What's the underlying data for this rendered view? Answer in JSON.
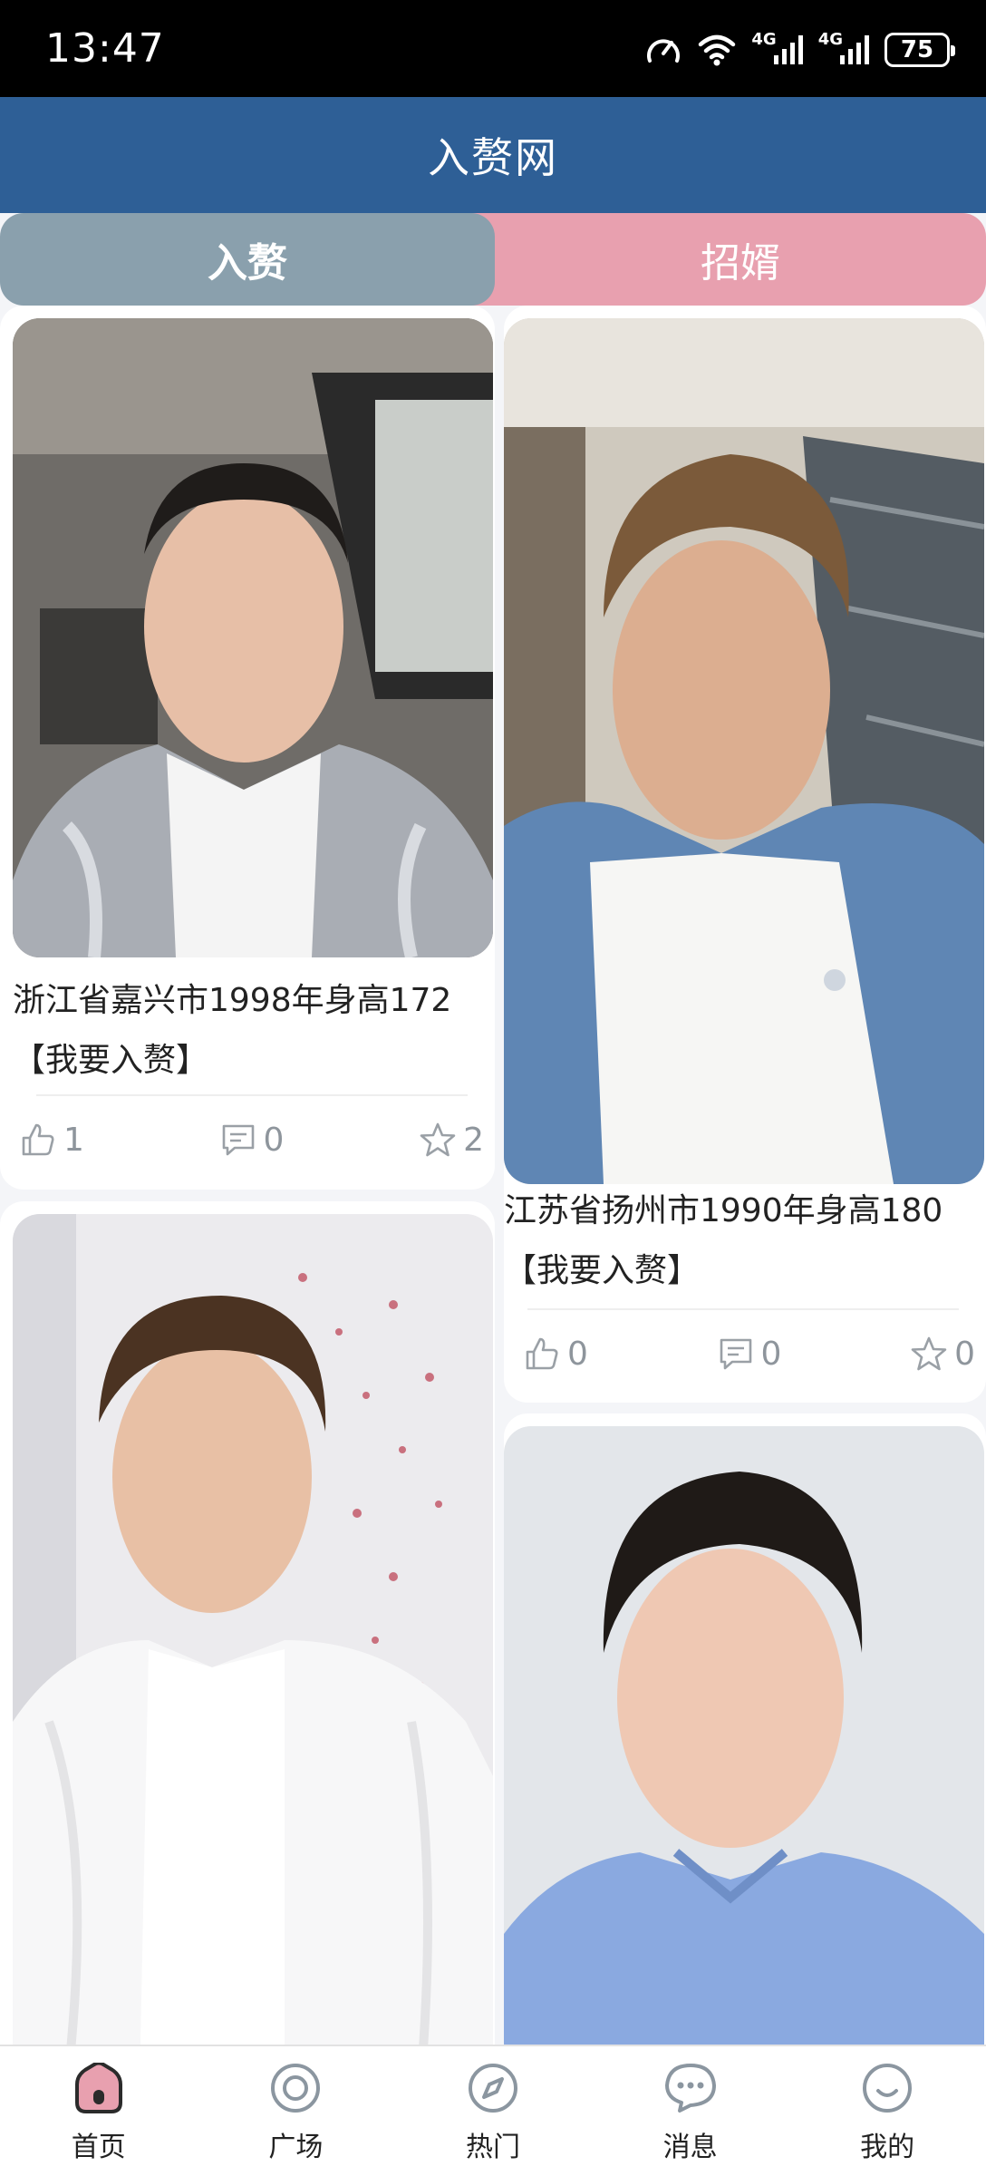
{
  "status_bar": {
    "time": "13:47",
    "network_1": "4G",
    "network_2": "4G",
    "battery": "75"
  },
  "header": {
    "title": "入赘网"
  },
  "tabs": [
    {
      "label": "入赘",
      "active": true
    },
    {
      "label": "招婿",
      "active": false
    }
  ],
  "cards": [
    {
      "title": "浙江省嘉兴市1998年身高172",
      "tag": "【我要入赘】",
      "likes": "1",
      "comments": "0",
      "favorites": "2"
    },
    {
      "title": "江苏省扬州市1990年身高180",
      "tag": "【我要入赘】",
      "likes": "0",
      "comments": "0",
      "favorites": "0"
    },
    {
      "title": "",
      "tag": "",
      "likes": "",
      "comments": "",
      "favorites": ""
    },
    {
      "title": "",
      "tag": "",
      "likes": "",
      "comments": "",
      "favorites": ""
    }
  ],
  "nav": [
    {
      "label": "首页",
      "icon": "home-icon",
      "active": true
    },
    {
      "label": "广场",
      "icon": "square-icon"
    },
    {
      "label": "热门",
      "icon": "compass-icon"
    },
    {
      "label": "消息",
      "icon": "message-icon"
    },
    {
      "label": "我的",
      "icon": "profile-icon"
    }
  ],
  "colors": {
    "header": "#2e5f96",
    "tab_active": "#8aa0ad",
    "tab_inactive": "#e8a0af",
    "home_active": "#e8a0af"
  }
}
